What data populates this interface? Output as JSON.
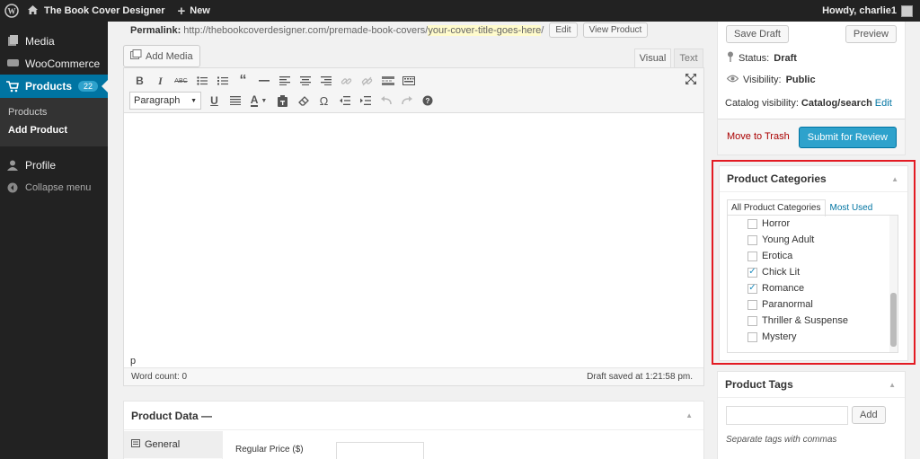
{
  "adminbar": {
    "site_name": "The Book Cover Designer",
    "new_label": "New",
    "howdy": "Howdy, charlie1"
  },
  "sidebar": {
    "items": [
      {
        "label": "Media",
        "icon": "media-icon"
      },
      {
        "label": "WooCommerce",
        "icon": "woocommerce-icon"
      },
      {
        "label": "Products",
        "icon": "cart-icon",
        "count": "22"
      }
    ],
    "submenu": [
      "Products",
      "Add Product"
    ],
    "profile": "Profile",
    "collapse": "Collapse menu"
  },
  "permalink": {
    "label": "Permalink:",
    "base": "http://thebookcoverdesigner.com/premade-book-covers/",
    "slug": "your-cover-title-goes-here",
    "trail": "/",
    "edit": "Edit",
    "view": "View Product"
  },
  "editor": {
    "add_media": "Add Media",
    "tab_visual": "Visual",
    "tab_text": "Text",
    "format": "Paragraph",
    "path": "p",
    "word_count": "Word count: 0",
    "draft_saved": "Draft saved at 1:21:58 pm."
  },
  "product_data": {
    "title": "Product Data —",
    "tab_general": "General",
    "regular_price_label": "Regular Price ($)"
  },
  "publish": {
    "save_draft": "Save Draft",
    "preview": "Preview",
    "status_label": "Status:",
    "status_value": "Draft",
    "visibility_label": "Visibility:",
    "visibility_value": "Public",
    "catalog_label": "Catalog visibility:",
    "catalog_value": "Catalog/search",
    "catalog_edit": "Edit",
    "trash": "Move to Trash",
    "submit": "Submit for Review"
  },
  "categories": {
    "title": "Product Categories",
    "tab_all": "All Product Categories",
    "tab_used": "Most Used",
    "items": [
      {
        "label": "Horror",
        "checked": false
      },
      {
        "label": "Young Adult",
        "checked": false
      },
      {
        "label": "Erotica",
        "checked": false
      },
      {
        "label": "Chick Lit",
        "checked": true
      },
      {
        "label": "Romance",
        "checked": true
      },
      {
        "label": "Paranormal",
        "checked": false
      },
      {
        "label": "Thriller & Suspense",
        "checked": false
      },
      {
        "label": "Mystery",
        "checked": false
      }
    ]
  },
  "tags": {
    "title": "Product Tags",
    "add": "Add",
    "hint": "Separate tags with commas"
  },
  "colors": {
    "adminbar": "#222222",
    "accent": "#0074a2",
    "highlight_box": "#e31b23",
    "submit": "#2ea2cc"
  }
}
